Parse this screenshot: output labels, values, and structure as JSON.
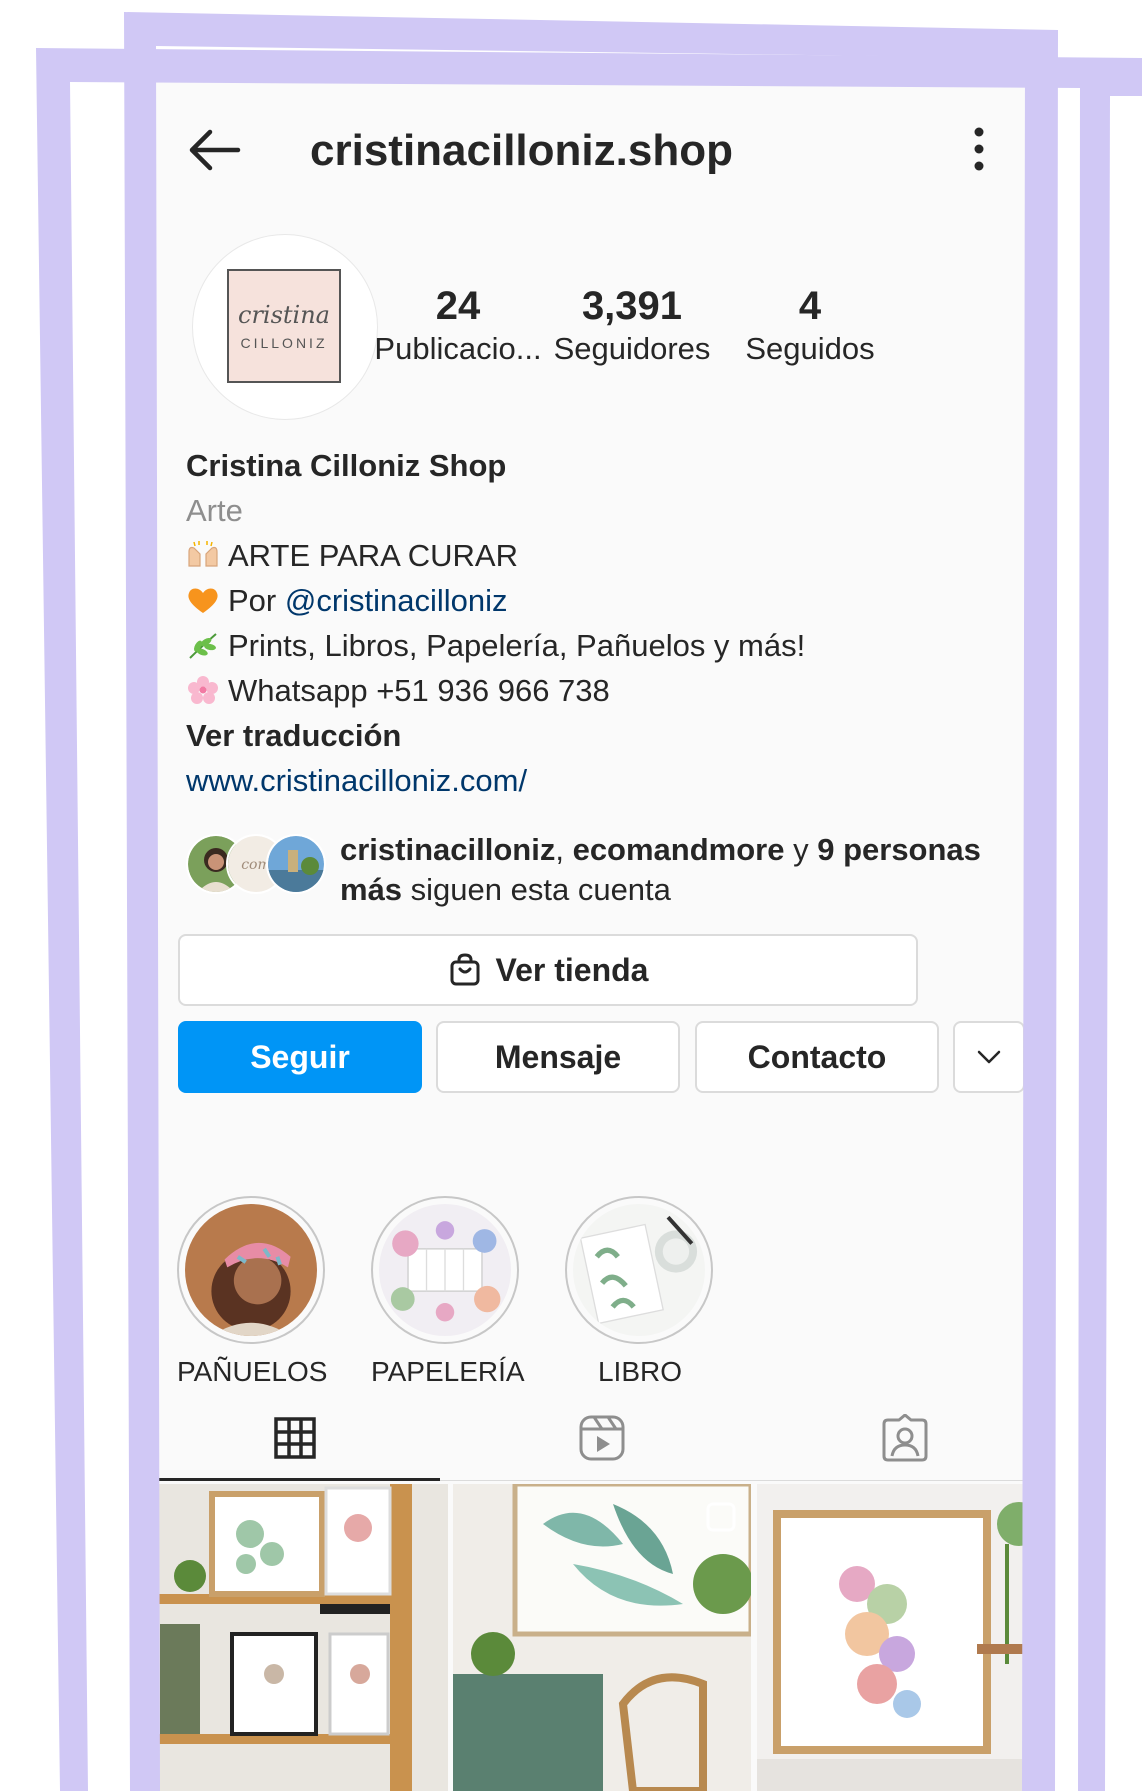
{
  "header": {
    "username": "cristinacilloniz.shop"
  },
  "profile": {
    "logo_script": "cristina",
    "logo_sub": "CILLONIZ",
    "stats": [
      {
        "value": "24",
        "label": "Publicacio..."
      },
      {
        "value": "3,391",
        "label": "Seguidores"
      },
      {
        "value": "4",
        "label": "Seguidos"
      }
    ],
    "name": "Cristina Cilloniz Shop",
    "category": "Arte",
    "bio_lines": [
      {
        "emoji": "raised-hands-icon",
        "text": "ARTE PARA CURAR"
      },
      {
        "emoji": "orange-heart-icon",
        "prefix": "Por ",
        "mention": "@cristinacilloniz"
      },
      {
        "emoji": "herb-icon",
        "text": "Prints, Libros, Papelería, Pañuelos y más!"
      },
      {
        "emoji": "cherry-blossom-icon",
        "text": "Whatsapp +51 936 966 738"
      }
    ],
    "translate": "Ver traducción",
    "website": "www.cristinacilloniz.com/"
  },
  "followed_by": {
    "user1": "cristinacilloniz",
    "sep1": ", ",
    "user2": "ecomandmore",
    "sep2": " y ",
    "others": "9 personas más",
    "suffix": " siguen esta cuenta"
  },
  "buttons": {
    "shop": "Ver tienda",
    "follow": "Seguir",
    "message": "Mensaje",
    "contact": "Contacto"
  },
  "highlights": [
    {
      "label": "PAÑUELOS"
    },
    {
      "label": "PAPELERÍA"
    },
    {
      "label": "LIBRO"
    }
  ],
  "tabs": [
    "grid-icon",
    "reels-icon",
    "tagged-icon"
  ],
  "colors": {
    "accent": "#0095f6",
    "frame": "#d0c8f5",
    "link": "#00376b"
  }
}
